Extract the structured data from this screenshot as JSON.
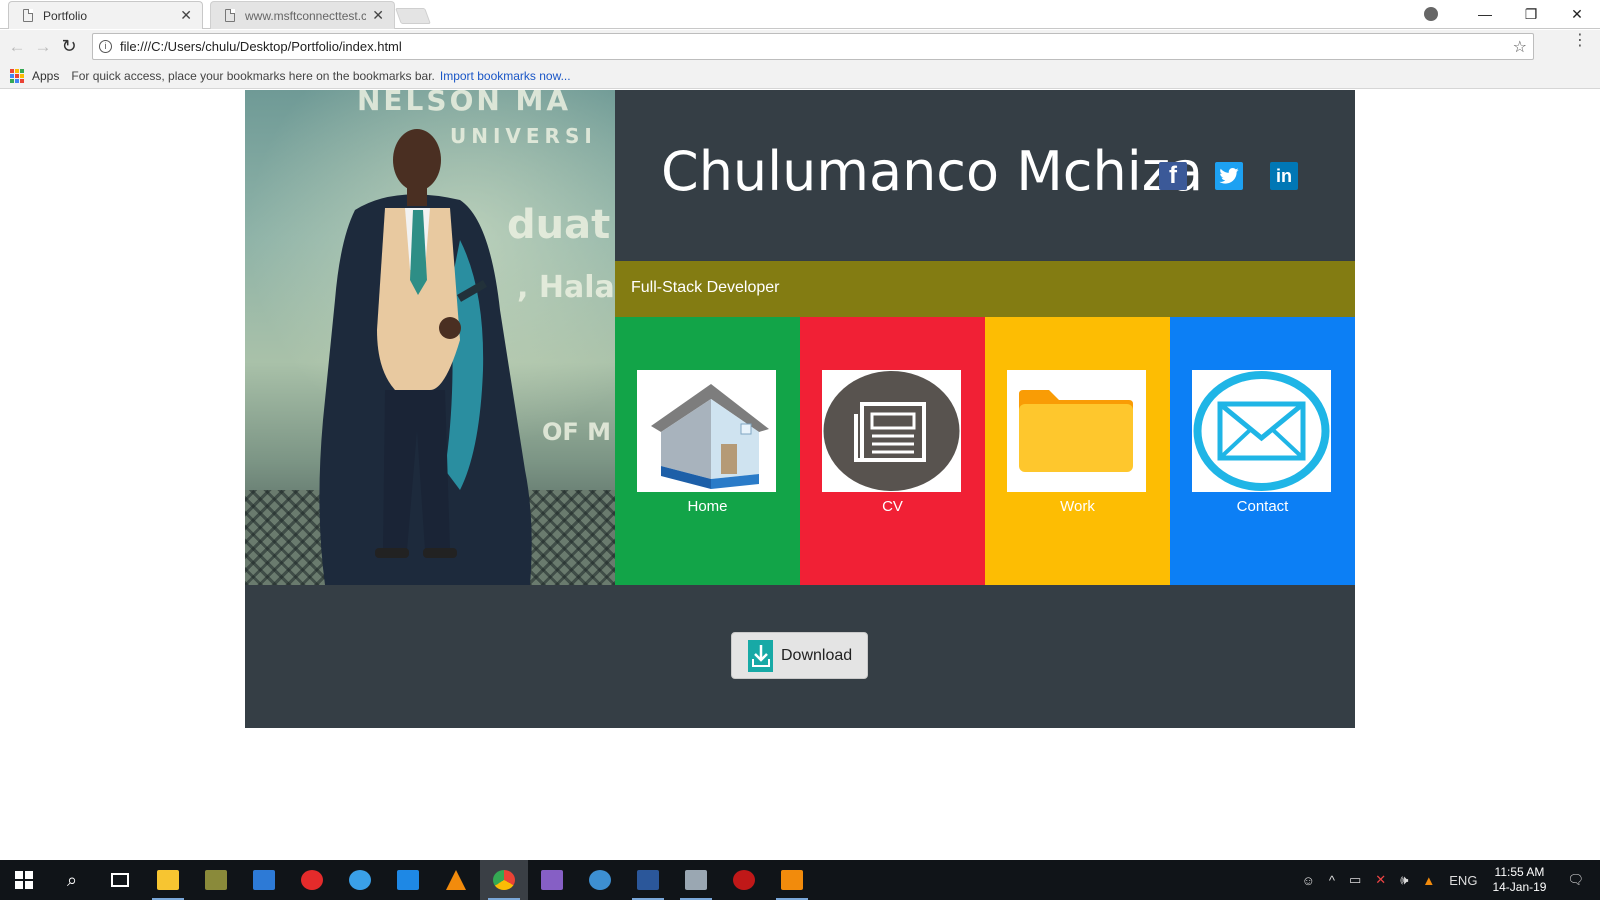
{
  "browser": {
    "tabs": [
      {
        "title": "Portfolio",
        "active": true
      },
      {
        "title": "www.msftconnecttest.co",
        "active": false
      }
    ],
    "url": "file:///C:/Users/chulu/Desktop/Portfolio/index.html",
    "bookmarks_bar": {
      "apps_label": "Apps",
      "hint": "For quick access, place your bookmarks here on the bookmarks bar.",
      "import_link": "Import bookmarks now..."
    }
  },
  "page": {
    "photo_banner_text": [
      "NELSON MA",
      "UNIVERSI",
      "duat",
      ", Hala",
      "OF M"
    ],
    "name": "Chulumanco Mchiza",
    "social": {
      "facebook": "f",
      "twitter": "t",
      "linkedin": "in"
    },
    "role": "Full-Stack Developer",
    "tiles": [
      {
        "label": "Home",
        "color": "#12a448",
        "icon": "house-icon"
      },
      {
        "label": "CV",
        "color": "#f12035",
        "icon": "newspaper-icon"
      },
      {
        "label": "Work",
        "color": "#fdbd03",
        "icon": "folder-icon"
      },
      {
        "label": "Contact",
        "color": "#0c7ff5",
        "icon": "envelope-icon"
      }
    ],
    "download_label": "Download",
    "colors": {
      "background": "#353e45",
      "role_bar": "#837c12"
    }
  },
  "taskbar": {
    "language": "ENG",
    "time": "11:55 AM",
    "date": "14-Jan-19"
  }
}
